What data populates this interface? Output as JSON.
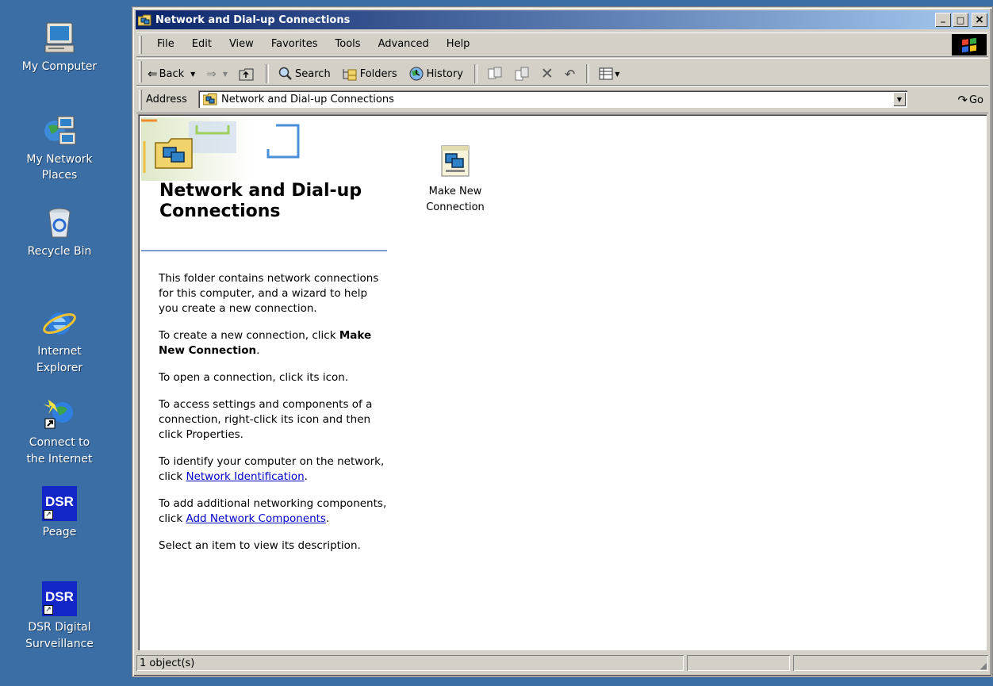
{
  "desktop": {
    "icons": [
      {
        "label_1": "My Computer",
        "label_2": ""
      },
      {
        "label_1": "My Network",
        "label_2": "Places"
      },
      {
        "label_1": "Recycle Bin",
        "label_2": ""
      },
      {
        "label_1": "Internet",
        "label_2": "Explorer"
      },
      {
        "label_1": "Connect to",
        "label_2": "the Internet"
      },
      {
        "label_1": "Peage",
        "label_2": "",
        "badge": "DSR"
      },
      {
        "label_1": "DSR Digital",
        "label_2": "Surveillance",
        "badge": "DSR"
      }
    ]
  },
  "window": {
    "title": "Network and Dial-up Connections",
    "buttons": {
      "minimize": "_",
      "maximize": "□",
      "close": "×"
    },
    "menu": [
      "File",
      "Edit",
      "View",
      "Favorites",
      "Tools",
      "Advanced",
      "Help"
    ],
    "toolbar": {
      "back": "Back",
      "search": "Search",
      "folders": "Folders",
      "history": "History"
    },
    "address": {
      "label": "Address",
      "value": "Network and Dial-up Connections",
      "go": "Go"
    },
    "banner_title": "Network and Dial-up Connections",
    "description": {
      "p1": "This folder contains network connections for this computer, and a wizard to help you create a new connection.",
      "p2_text": "To create a new connection, click ",
      "p2_bold": "Make New Connection",
      "p2_end": ".",
      "p3": "To open a connection, click its icon.",
      "p4": "To access settings and components of a connection, right-click its icon and then click Properties.",
      "p5_text": "To identify your computer on the network, click ",
      "p5_link": "Network Identification",
      "p5_end": ".",
      "p6_text": "To add additional networking components, click ",
      "p6_link": "Add Network Components",
      "p6_end": ".",
      "p7": "Select an item to view its description."
    },
    "items": [
      {
        "label_1": "Make New",
        "label_2": "Connection"
      }
    ],
    "status": {
      "objects": "1 object(s)"
    }
  },
  "colors": {
    "desktop": "#3a6ea5",
    "title_start": "#0a246a",
    "title_end": "#a6caf0",
    "chrome": "#d4d0c8",
    "link": "#0000cc"
  }
}
